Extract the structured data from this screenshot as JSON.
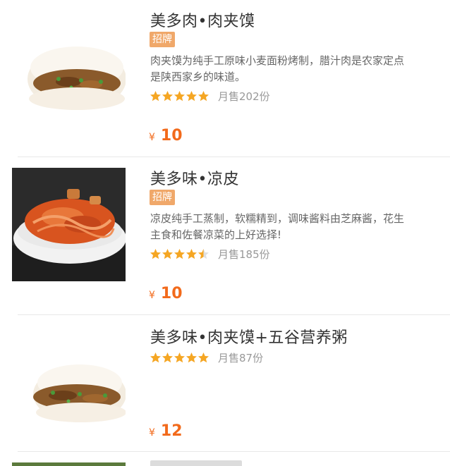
{
  "items": [
    {
      "title": "美多肉•肉夹馍",
      "badge": "招牌",
      "desc_line1": "肉夹馍为纯手工原味小麦面粉烤制，腊汁肉是农家定点",
      "desc_line2": "是陕西家乡的味道。",
      "rating": 5,
      "sales": "月售202份",
      "currency": "¥",
      "price": "10",
      "image_icon": "roujiamo-photo"
    },
    {
      "title": "美多味•凉皮",
      "badge": "招牌",
      "desc_line1": "凉皮纯手工蒸制，软糯精到，调味酱料由芝麻酱，花生",
      "desc_line2": "主食和佐餐凉菜的上好选择!",
      "rating": 4.5,
      "sales": "月售185份",
      "currency": "¥",
      "price": "10",
      "image_icon": "liangpi-photo"
    },
    {
      "title": "美多味•肉夹馍+五谷营养粥",
      "rating": 5,
      "sales": "月售87份",
      "currency": "¥",
      "price": "12",
      "image_icon": "roujiamo-photo"
    }
  ],
  "colors": {
    "accent_price": "#f26a1b",
    "star": "#f5a623",
    "badge_bg": "#f0a86a",
    "divider": "#e8e8e8"
  }
}
